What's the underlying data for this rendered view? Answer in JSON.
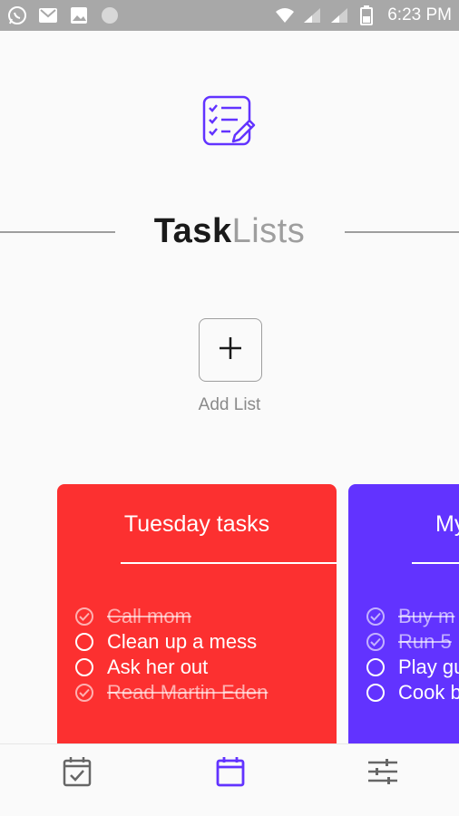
{
  "status_bar": {
    "time": "6:23 PM",
    "left_icons": [
      "whatsapp-icon",
      "gmail-icon",
      "image-icon",
      "circle-icon"
    ],
    "right_icons": [
      "wifi-icon",
      "signal-icon",
      "signal-icon",
      "battery-icon"
    ]
  },
  "header": {
    "logo_icon": "tasklist-edit-icon",
    "title_bold": "Task",
    "title_light": "Lists"
  },
  "add_list": {
    "icon": "plus-icon",
    "label": "Add List"
  },
  "cards": [
    {
      "title": "Tuesday tasks",
      "color": "#fc3030",
      "tasks": [
        {
          "text": "Call mom",
          "done": true
        },
        {
          "text": "Clean up a mess",
          "done": false
        },
        {
          "text": "Ask her out",
          "done": false
        },
        {
          "text": "Read Martin Eden",
          "done": true
        }
      ]
    },
    {
      "title": "My",
      "color": "#6233ff",
      "tasks": [
        {
          "text": "Buy m",
          "done": true
        },
        {
          "text": "Run 5",
          "done": true
        },
        {
          "text": "Play gu",
          "done": false
        },
        {
          "text": "Cook b",
          "done": false
        }
      ]
    }
  ],
  "bottom_nav": {
    "items": [
      {
        "icon": "calendar-check-icon",
        "active": false
      },
      {
        "icon": "calendar-icon",
        "active": true
      },
      {
        "icon": "settings-sliders-icon",
        "active": false
      }
    ],
    "active_color": "#6233ff",
    "inactive_color": "#666666"
  }
}
